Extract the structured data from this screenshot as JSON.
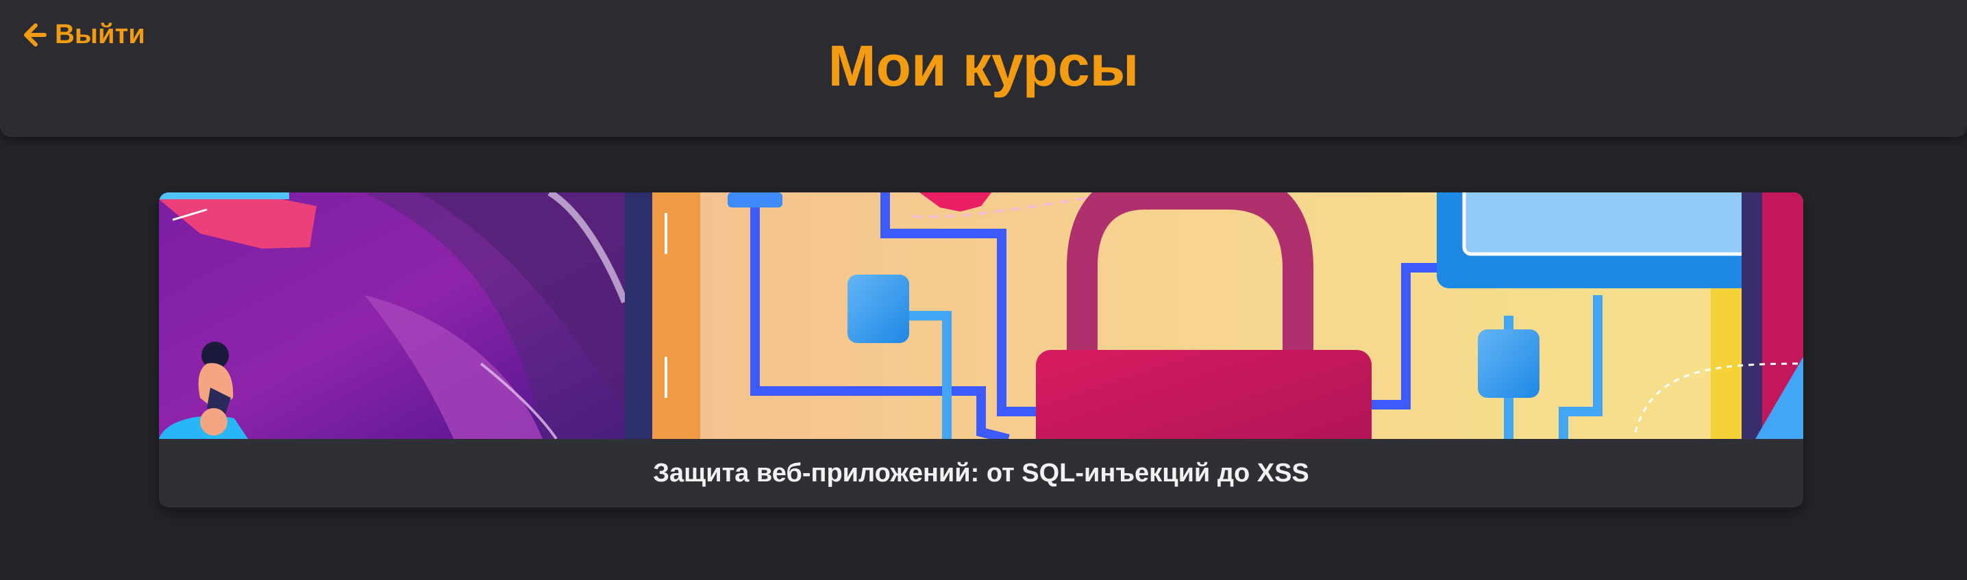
{
  "header": {
    "back_label": "Выйти",
    "title": "Мои курсы"
  },
  "courses": [
    {
      "title": "Защита веб-приложений: от SQL-инъекций до XSS"
    }
  ],
  "colors": {
    "accent": "#f39c12",
    "background": "#222428",
    "header_bg": "#2a2c31",
    "card_bg": "#2e3035"
  }
}
